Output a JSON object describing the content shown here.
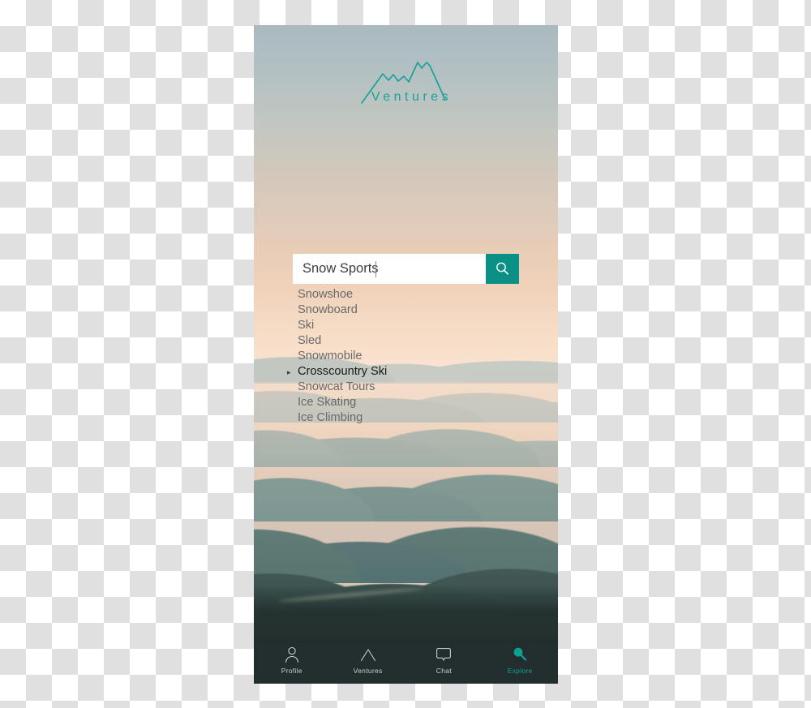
{
  "app": {
    "brand_name": "Ventures",
    "logo_icon": "mountain-peaks-icon",
    "accent_color": "#0b9085",
    "nav_background": "#222e2e"
  },
  "search": {
    "value": "Snow Sports",
    "placeholder": "Search",
    "button_icon": "search-icon",
    "button_label": "Search"
  },
  "suggestions": {
    "marker": "▸",
    "items": [
      {
        "label": "Snowshoe",
        "selected": false
      },
      {
        "label": "Snowboard",
        "selected": false
      },
      {
        "label": "Ski",
        "selected": false
      },
      {
        "label": "Sled",
        "selected": false
      },
      {
        "label": "Snowmobile",
        "selected": false
      },
      {
        "label": "Crosscountry Ski",
        "selected": true
      },
      {
        "label": "Snowcat Tours",
        "selected": false
      },
      {
        "label": "Ice Skating",
        "selected": false
      },
      {
        "label": "Ice Climbing",
        "selected": false
      }
    ]
  },
  "bottom_nav": {
    "items": [
      {
        "label": "Profile",
        "icon": "person-icon",
        "active": false
      },
      {
        "label": "Ventures",
        "icon": "mountain-icon",
        "active": false
      },
      {
        "label": "Chat",
        "icon": "speech-bubble-icon",
        "active": false
      },
      {
        "label": "Explore",
        "icon": "search-icon",
        "active": true
      }
    ]
  }
}
